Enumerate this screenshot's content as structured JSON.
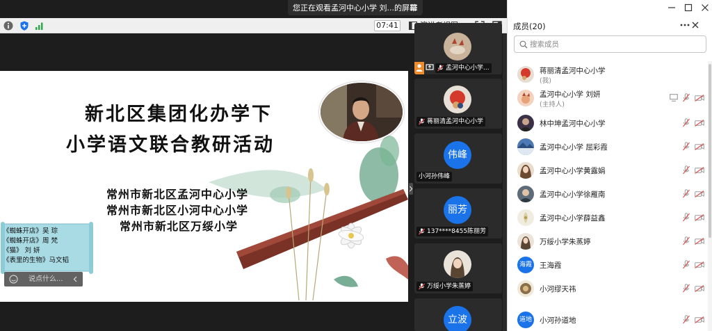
{
  "banner": {
    "text": "您正在观看孟河中心小学  刘...的屏幕",
    "menu_icon": "menu-icon"
  },
  "toolbar": {
    "timer": "07:41",
    "view_label": "演讲者视图",
    "icons": [
      "info-icon",
      "shield-icon",
      "signal-icon",
      "presenter-view-icon",
      "chevron-down-icon",
      "fullscreen-icon",
      "layout-icon"
    ]
  },
  "slide": {
    "title_line1": "新北区集团化办学下",
    "title_line2": "小学语文联合教研活动",
    "schools": [
      "常州市新北区孟河中心小学",
      "常州市新北区小河中心小学",
      "常州市新北区万绥小学"
    ],
    "lessons": [
      "《蜘蛛开店》吴  琮",
      "《蜘蛛开店》周  梵",
      "《猫》  刘  妍",
      "《表里的生物》马文韬"
    ]
  },
  "chat": {
    "placeholder": "说点什么..."
  },
  "gallery": [
    {
      "name": "孟河中心小学...",
      "type": "image"
    },
    {
      "name": "蒋丽清孟河中心小学",
      "type": "image"
    },
    {
      "name": "小河孙伟峰",
      "avatar_text": "伟峰",
      "type": "text"
    },
    {
      "name": "137****8455陈丽芳",
      "avatar_text": "丽芳",
      "type": "text"
    },
    {
      "name": "万绥小学朱蒸婷",
      "type": "image"
    },
    {
      "name": "",
      "avatar_text": "立波",
      "type": "text"
    }
  ],
  "panel": {
    "title": "成员(20)",
    "search_placeholder": "搜索成员",
    "members": [
      {
        "name": "蒋丽清孟河中心小学",
        "sub": "(我)",
        "avatar": "image",
        "color": "#c95a3a"
      },
      {
        "name": "孟河中心小学  刘妍",
        "sub": "(主持人)",
        "avatar": "image",
        "color": "#e8a27a",
        "sharing": true
      },
      {
        "name": "林中坤孟河中心小学",
        "avatar": "image",
        "color": "#3b3146"
      },
      {
        "name": "孟河中心小学  屈彩霞",
        "avatar": "image",
        "color": "#4d79b5"
      },
      {
        "name": "孟河中心小学黄露娟",
        "avatar": "image",
        "color": "#a7714e"
      },
      {
        "name": "孟河中心小学徐雁南",
        "avatar": "image",
        "color": "#5d6c78"
      },
      {
        "name": "孟河中心小学薛益鑫",
        "avatar": "image",
        "color": "#d9cfa8"
      },
      {
        "name": "万绥小学朱蒸婷",
        "avatar": "image",
        "color": "#c9a58c"
      },
      {
        "name": "王海霞",
        "avatar": "text",
        "avatar_text": "海霞",
        "color": "#1a73e8"
      },
      {
        "name": "小河缪天祎",
        "avatar": "image",
        "color": "#8a6e4b"
      },
      {
        "name": "小河孙道地",
        "avatar": "text",
        "avatar_text": "道地",
        "color": "#1a73e8"
      }
    ]
  },
  "colors": {
    "accent": "#1a73e8",
    "muted_red": "#e05252",
    "dark_bg": "#1d1d1d"
  }
}
